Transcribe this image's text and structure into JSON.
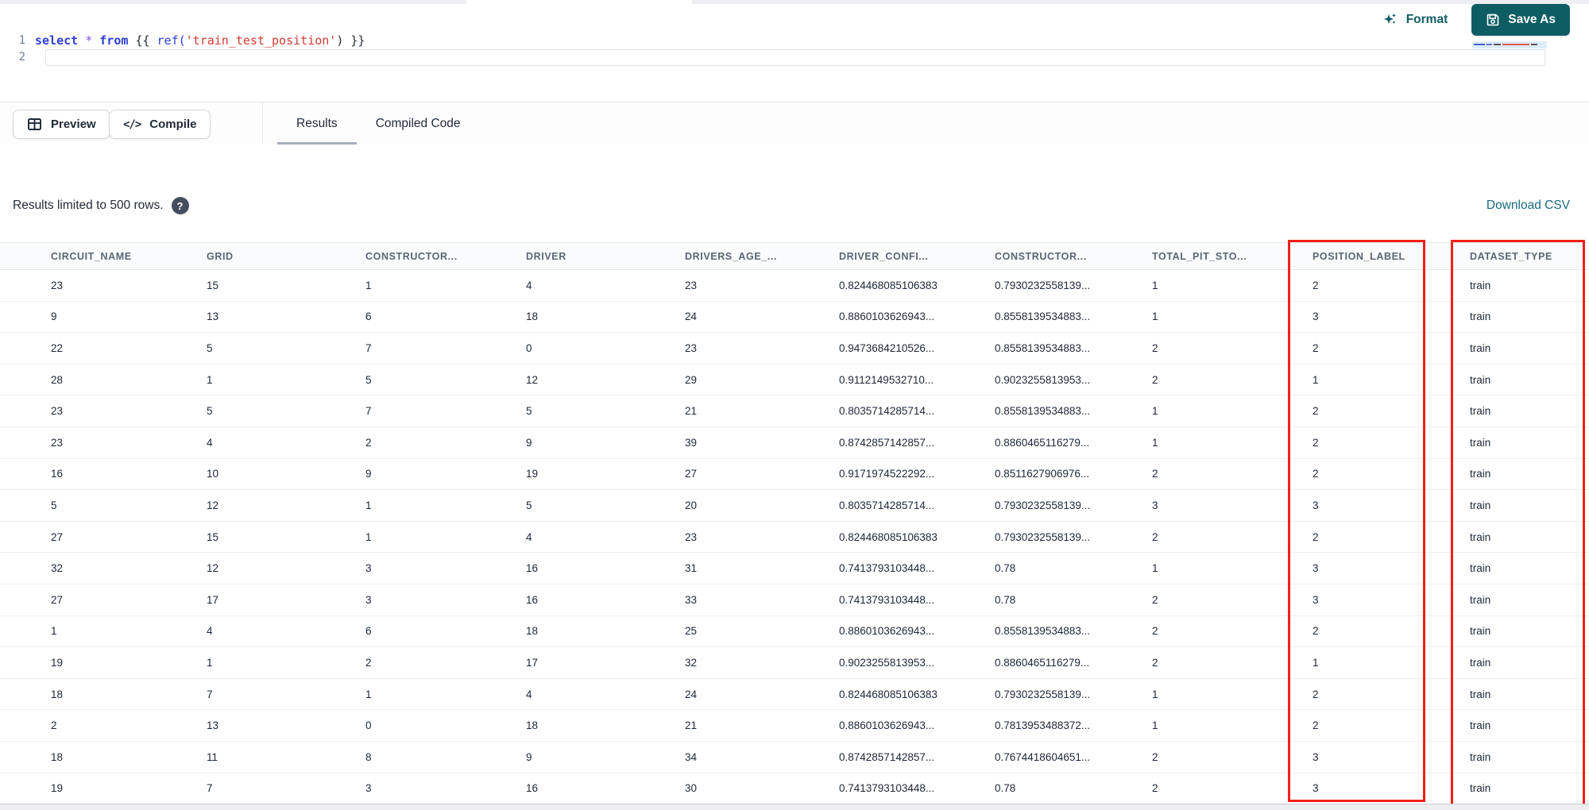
{
  "editor": {
    "lines": [
      {
        "number": "1",
        "tokens": [
          {
            "t": "select",
            "c": "kw"
          },
          {
            "t": " ",
            "c": "pl"
          },
          {
            "t": "*",
            "c": "op"
          },
          {
            "t": " ",
            "c": "pl"
          },
          {
            "t": "from",
            "c": "kw"
          },
          {
            "t": " ",
            "c": "pl"
          },
          {
            "t": "{{ ",
            "c": "br"
          },
          {
            "t": "ref(",
            "c": "fn"
          },
          {
            "t": "'train_test_position'",
            "c": "str"
          },
          {
            "t": ")",
            "c": "br"
          },
          {
            "t": " }}",
            "c": "br"
          }
        ]
      },
      {
        "number": "2",
        "tokens": []
      }
    ]
  },
  "top_actions": {
    "format_label": "Format",
    "save_as_label": "Save As"
  },
  "toolbar": {
    "preview_label": "Preview",
    "compile_label": "Compile",
    "compile_glyph": "</>",
    "tabs": [
      {
        "label": "Results",
        "active": true
      },
      {
        "label": "Compiled Code",
        "active": false
      }
    ]
  },
  "status": {
    "limit_text": "Results limited to 500 rows.",
    "help_glyph": "?",
    "download_csv_label": "Download CSV"
  },
  "table": {
    "columns": [
      "CIRCUIT_NAME",
      "GRID",
      "CONSTRUCTOR...",
      "DRIVER",
      "DRIVERS_AGE_...",
      "DRIVER_CONFI...",
      "CONSTRUCTOR...",
      "TOTAL_PIT_STO...",
      "POSITION_LABEL",
      "DATASET_TYPE"
    ],
    "highlighted_columns": [
      "POSITION_LABEL",
      "DATASET_TYPE"
    ],
    "rows": [
      [
        "23",
        "15",
        "1",
        "4",
        "23",
        "0.824468085106383",
        "0.7930232558139...",
        "1",
        "2",
        "train"
      ],
      [
        "9",
        "13",
        "6",
        "18",
        "24",
        "0.8860103626943...",
        "0.8558139534883...",
        "1",
        "3",
        "train"
      ],
      [
        "22",
        "5",
        "7",
        "0",
        "23",
        "0.9473684210526...",
        "0.8558139534883...",
        "2",
        "2",
        "train"
      ],
      [
        "28",
        "1",
        "5",
        "12",
        "29",
        "0.9112149532710...",
        "0.9023255813953...",
        "2",
        "1",
        "train"
      ],
      [
        "23",
        "5",
        "7",
        "5",
        "21",
        "0.8035714285714...",
        "0.8558139534883...",
        "1",
        "2",
        "train"
      ],
      [
        "23",
        "4",
        "2",
        "9",
        "39",
        "0.8742857142857...",
        "0.8860465116279...",
        "1",
        "2",
        "train"
      ],
      [
        "16",
        "10",
        "9",
        "19",
        "27",
        "0.9171974522292...",
        "0.8511627906976...",
        "2",
        "2",
        "train"
      ],
      [
        "5",
        "12",
        "1",
        "5",
        "20",
        "0.8035714285714...",
        "0.7930232558139...",
        "3",
        "3",
        "train"
      ],
      [
        "27",
        "15",
        "1",
        "4",
        "23",
        "0.824468085106383",
        "0.7930232558139...",
        "2",
        "2",
        "train"
      ],
      [
        "32",
        "12",
        "3",
        "16",
        "31",
        "0.7413793103448...",
        "0.78",
        "1",
        "3",
        "train"
      ],
      [
        "27",
        "17",
        "3",
        "16",
        "33",
        "0.7413793103448...",
        "0.78",
        "2",
        "3",
        "train"
      ],
      [
        "1",
        "4",
        "6",
        "18",
        "25",
        "0.8860103626943...",
        "0.8558139534883...",
        "2",
        "2",
        "train"
      ],
      [
        "19",
        "1",
        "2",
        "17",
        "32",
        "0.9023255813953...",
        "0.8860465116279...",
        "2",
        "1",
        "train"
      ],
      [
        "18",
        "7",
        "1",
        "4",
        "24",
        "0.824468085106383",
        "0.7930232558139...",
        "1",
        "2",
        "train"
      ],
      [
        "2",
        "13",
        "0",
        "18",
        "21",
        "0.8860103626943...",
        "0.7813953488372...",
        "1",
        "2",
        "train"
      ],
      [
        "18",
        "11",
        "8",
        "9",
        "34",
        "0.8742857142857...",
        "0.7674418604651...",
        "2",
        "3",
        "train"
      ],
      [
        "19",
        "7",
        "3",
        "16",
        "30",
        "0.7413793103448...",
        "0.78",
        "2",
        "3",
        "train"
      ]
    ]
  },
  "colors": {
    "accent_teal": "#0d5d63",
    "link_teal": "#19697f",
    "annotation_red": "#f2201a",
    "keyword_blue": "#2e40d4",
    "string_red": "#d23b31"
  }
}
